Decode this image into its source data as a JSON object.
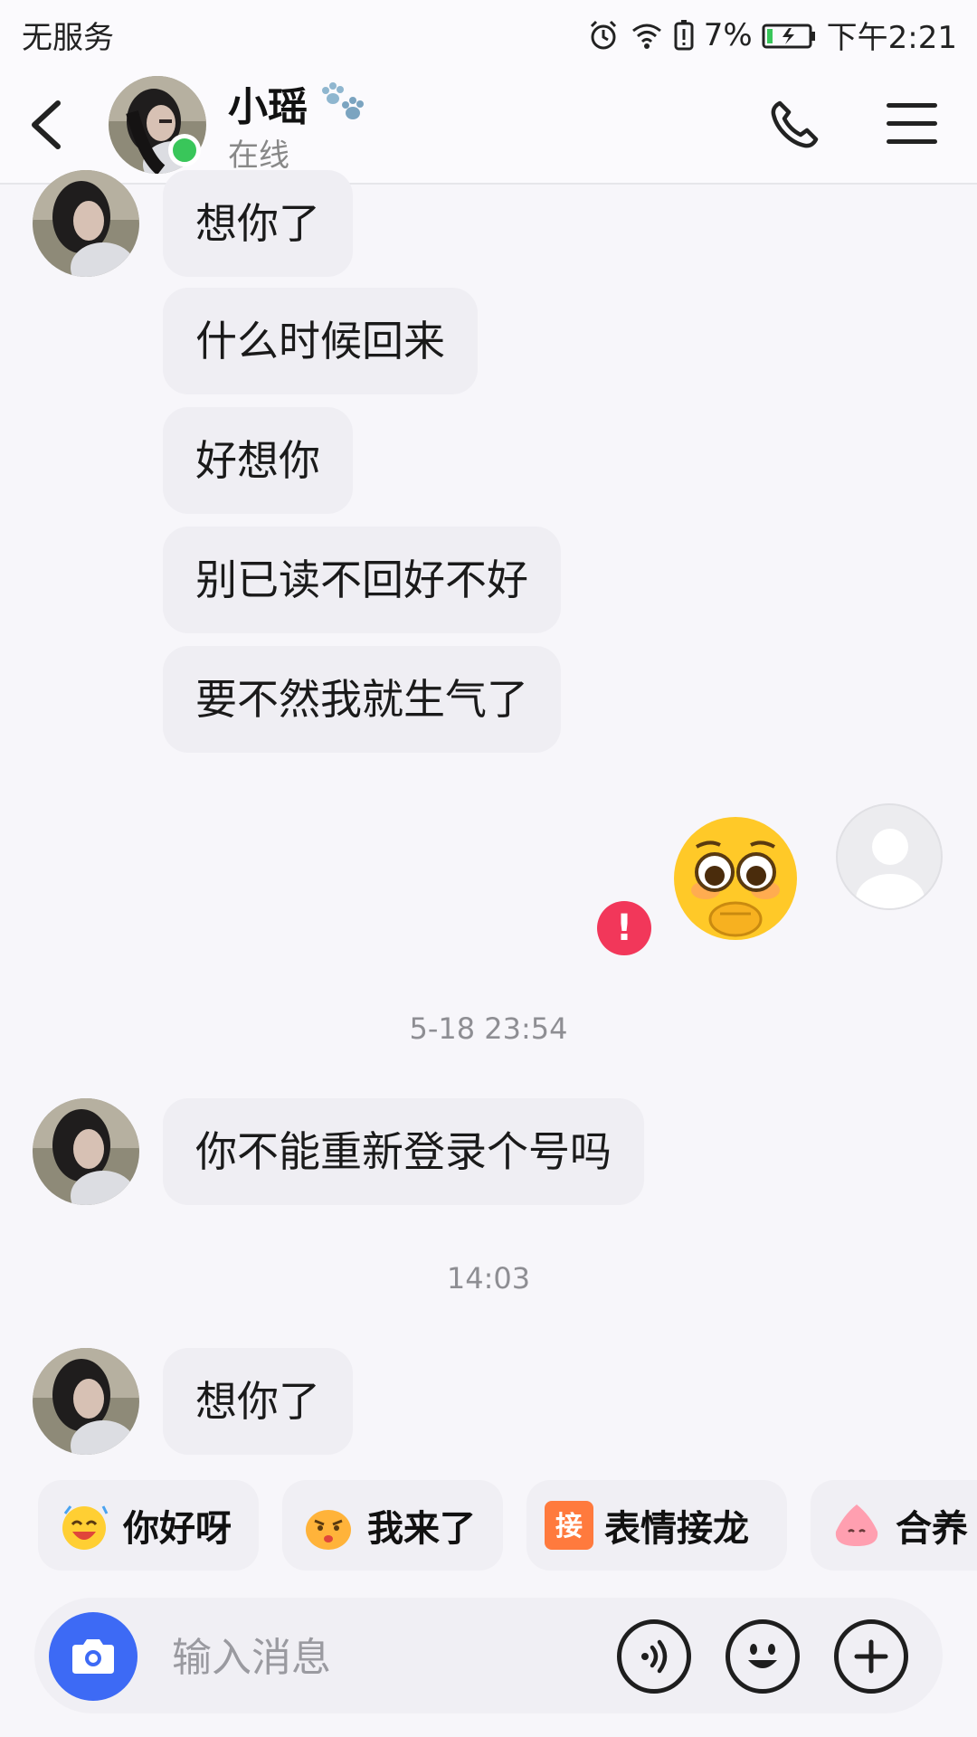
{
  "status_bar": {
    "carrier": "无服务",
    "battery_percent": "7%",
    "time": "下午2:21"
  },
  "header": {
    "contact_name": "小瑶",
    "contact_status": "在线"
  },
  "messages": [
    {
      "side": "left",
      "text": "想你了"
    },
    {
      "side": "left",
      "text": "什么时候回来"
    },
    {
      "side": "left",
      "text": "好想你"
    },
    {
      "side": "left",
      "text": "别已读不回好不好"
    },
    {
      "side": "left",
      "text": "要不然我就生气了"
    },
    {
      "side": "right",
      "type": "emoji",
      "failed_mark": "!"
    },
    {
      "type": "timestamp",
      "text": "5-18 23:54"
    },
    {
      "side": "left",
      "text": "你不能重新登录个号吗"
    },
    {
      "type": "timestamp",
      "text": "14:03"
    },
    {
      "side": "left",
      "text": "想你了"
    }
  ],
  "quick_chips": [
    {
      "label": "你好呀",
      "icon": "laughing-sticker-icon"
    },
    {
      "label": "我来了",
      "icon": "pout-sticker-icon"
    },
    {
      "label": "表情接龙",
      "icon": "jie-badge-icon",
      "badge": "接"
    },
    {
      "label": "合养",
      "icon": "pink-pet-icon"
    }
  ],
  "input": {
    "placeholder": "输入消息"
  },
  "colors": {
    "accent": "#3d6af5",
    "online": "#39c65a",
    "error": "#f2375a",
    "bubble": "#efeef3"
  }
}
